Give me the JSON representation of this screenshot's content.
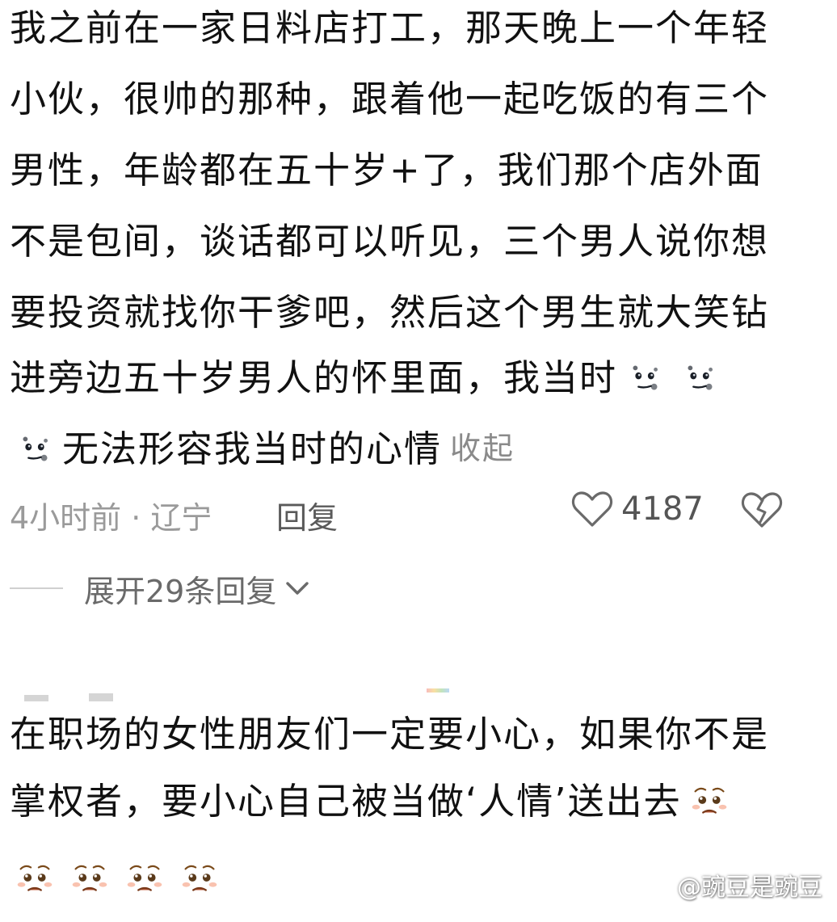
{
  "comment1": {
    "lines": [
      "我之前在一家日料店打工，那天晚上一个年轻",
      "小伙，很帅的那种，跟着他一起吃饭的有三个",
      "男性，年龄都在五十岁+了，我们那个店外面",
      "不是包间，谈话都可以听见，三个男人说你想",
      "要投资就找你干爹吧，然后这个男生就大笑钻",
      "进旁边五十岁男人的怀里面，我当时"
    ],
    "line7_text": "无法形容我当时的心情",
    "collapse_label": "收起",
    "emoji_name": "new-moon-face",
    "time": "4小时前 · 辽宁",
    "reply_label": "回复",
    "like_count": "4187",
    "expand_label": "展开29条回复"
  },
  "comment2": {
    "lines": [
      "在职场的女性朋友们一定要小心，如果你不是",
      "掌权者，要小心自己被当做‘人情’送出去"
    ],
    "emoji_name": "pleading-face"
  },
  "watermark": "@豌豆是豌豆",
  "colors": {
    "text": "#111111",
    "meta": "#9a9a9a",
    "accent_gray": "#5a5a5a",
    "moon_face": "#3d4654",
    "pleading_face": "#f6c945"
  },
  "icons": [
    "heart-outline-icon",
    "broken-heart-icon",
    "chevron-down-icon",
    "paw-icon"
  ]
}
